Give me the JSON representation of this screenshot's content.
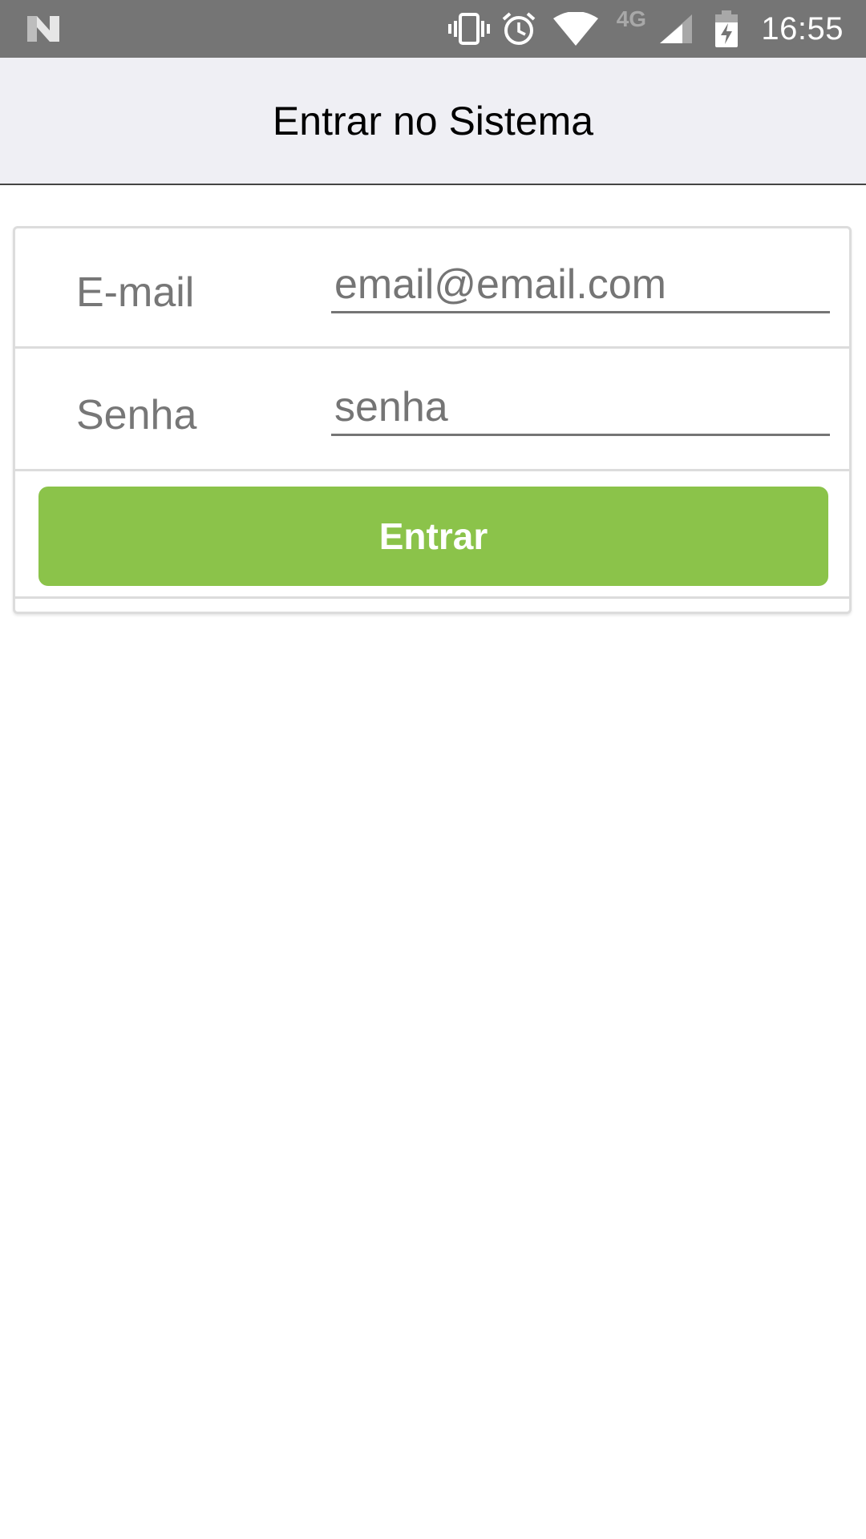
{
  "status_bar": {
    "time": "16:55",
    "network_label": "4G",
    "icons": [
      "n-logo-icon",
      "vibrate-icon",
      "alarm-icon",
      "wifi-icon",
      "signal-icon",
      "battery-charging-icon"
    ],
    "background_color": "#757575"
  },
  "header": {
    "title": "Entrar no Sistema",
    "background_color": "#efeff4"
  },
  "form": {
    "email": {
      "label": "E-mail",
      "placeholder": "email@email.com",
      "value": ""
    },
    "password": {
      "label": "Senha",
      "placeholder": "senha",
      "value": ""
    },
    "submit_label": "Entrar",
    "submit_color": "#8bc34a"
  }
}
